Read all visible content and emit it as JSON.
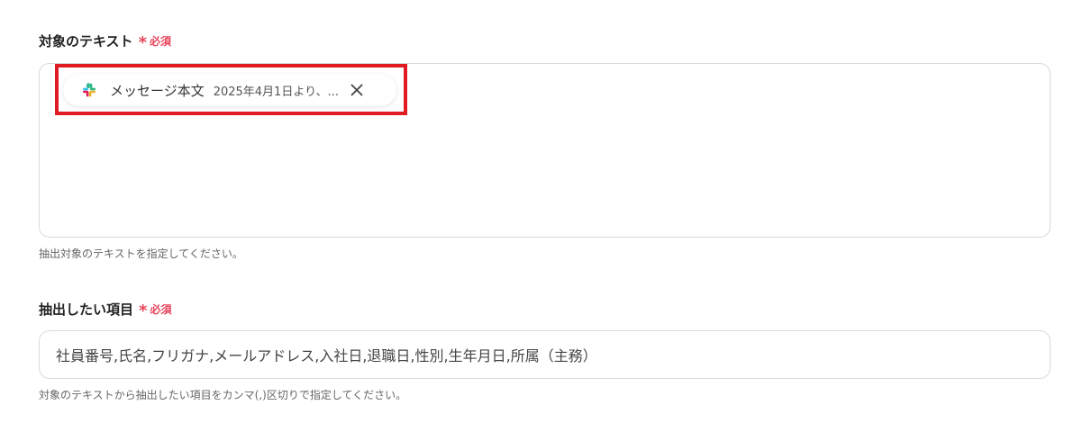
{
  "target_text_field": {
    "label": "対象のテキスト",
    "required_star": "*",
    "required_label": "必須",
    "chip": {
      "icon": "slack-icon",
      "title": "メッセージ本文",
      "preview": "2025年4月1日より、...",
      "close_icon": "close-icon"
    },
    "help": "抽出対象のテキストを指定してください。"
  },
  "extract_items_field": {
    "label": "抽出したい項目",
    "required_star": "*",
    "required_label": "必須",
    "value": "社員番号,氏名,フリガナ,メールアドレス,入社日,退職日,性別,生年月日,所属（主務）",
    "help": "対象のテキストから抽出したい項目をカンマ(,)区切りで指定してください。"
  },
  "colors": {
    "required": "#e8445a",
    "highlight": "#e01b22",
    "border": "#d6d9de"
  }
}
